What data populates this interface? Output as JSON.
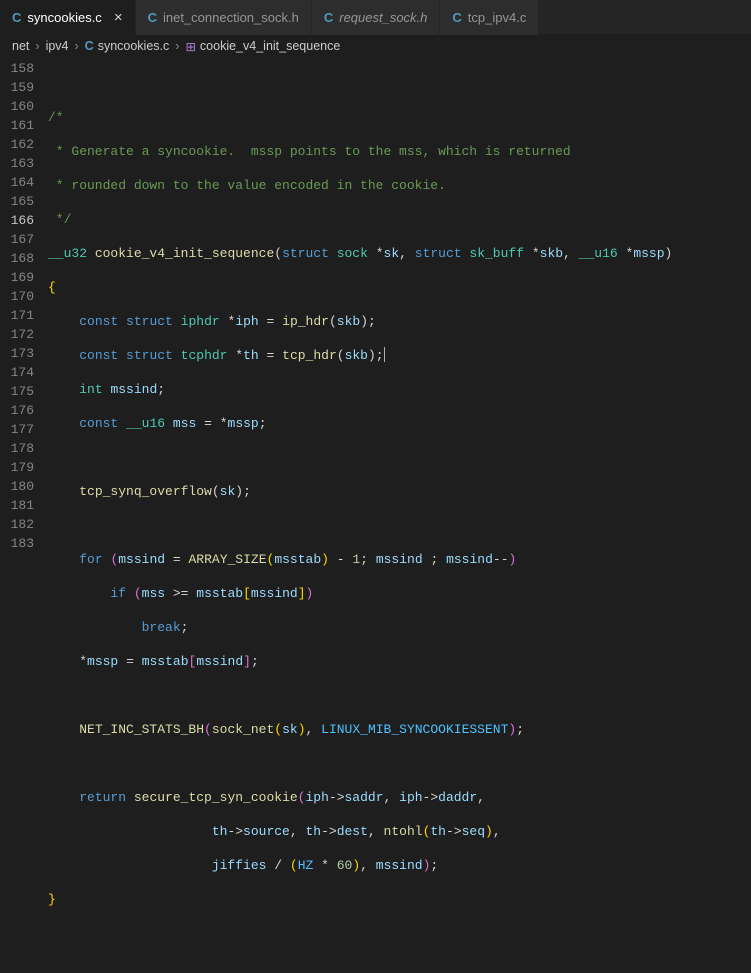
{
  "tabs": [
    {
      "icon": "C",
      "label": "syncookies.c",
      "active": true,
      "close": true
    },
    {
      "icon": "C",
      "label": "inet_connection_sock.h",
      "active": false
    },
    {
      "icon": "C",
      "label": "request_sock.h",
      "active": false,
      "italic": true
    },
    {
      "icon": "C",
      "label": "tcp_ipv4.c",
      "active": false
    }
  ],
  "breadcrumbs": {
    "p1": "net",
    "p2": "ipv4",
    "file_icon": "C",
    "file": "syncookies.c",
    "symbol": "cookie_v4_init_sequence"
  },
  "lines": {
    "start": 158,
    "active": 166,
    "count": 26
  },
  "code": {
    "c159": "/*",
    "c160": " * Generate a syncookie.  mssp points to the mss, which is returned",
    "c161": " * rounded down to the value encoded in the cookie.",
    "c162": " */",
    "fn_type": "__u32",
    "fn_name": "cookie_v4_init_sequence",
    "fn_params_raw": "(struct sock *sk, struct sk_buff *skb, __u16 *mssp)",
    "l165": {
      "kw1": "const",
      "kw2": "struct",
      "type": "iphdr",
      "ptr": "*",
      "var": "iph",
      "eq": "=",
      "fn": "ip_hdr",
      "arg": "skb"
    },
    "l166": {
      "kw1": "const",
      "kw2": "struct",
      "type": "tcphdr",
      "ptr": "*",
      "var": "th",
      "eq": "=",
      "fn": "tcp_hdr",
      "arg": "skb"
    },
    "l167": {
      "type": "int",
      "var": "mssind"
    },
    "l168": {
      "kw": "const",
      "type": "__u16",
      "var": "mss",
      "eq": "=",
      "deref": "*",
      "src": "mssp"
    },
    "l170": {
      "fn": "tcp_synq_overflow",
      "arg": "sk"
    },
    "l172": {
      "kw": "for",
      "var1": "mssind",
      "fn": "ARRAY_SIZE",
      "arr": "msstab",
      "minus": "-",
      "one": "1",
      "var2": "mssind",
      "var3": "mssind",
      "dec": "--"
    },
    "l173": {
      "kw": "if",
      "var": "mss",
      "op": ">=",
      "arr": "msstab",
      "idx": "mssind"
    },
    "l174": {
      "kw": "break"
    },
    "l175": {
      "deref": "*",
      "dst": "mssp",
      "eq": "=",
      "arr": "msstab",
      "idx": "mssind"
    },
    "l177": {
      "fn": "NET_INC_STATS_BH",
      "inner_fn": "sock_net",
      "inner_arg": "sk",
      "const": "LINUX_MIB_SYNCOOKIESSENT"
    },
    "l179": {
      "kw": "return",
      "fn": "secure_tcp_syn_cookie",
      "a1a": "iph",
      "a1b": "saddr",
      "a2a": "iph",
      "a2b": "daddr"
    },
    "l180": {
      "a1a": "th",
      "a1b": "source",
      "a2a": "th",
      "a2b": "dest",
      "fn": "ntohl",
      "a3a": "th",
      "a3b": "seq"
    },
    "l181": {
      "v1": "jiffies",
      "op": "/",
      "c1": "HZ",
      "mul": "*",
      "n": "60",
      "v2": "mssind"
    }
  }
}
